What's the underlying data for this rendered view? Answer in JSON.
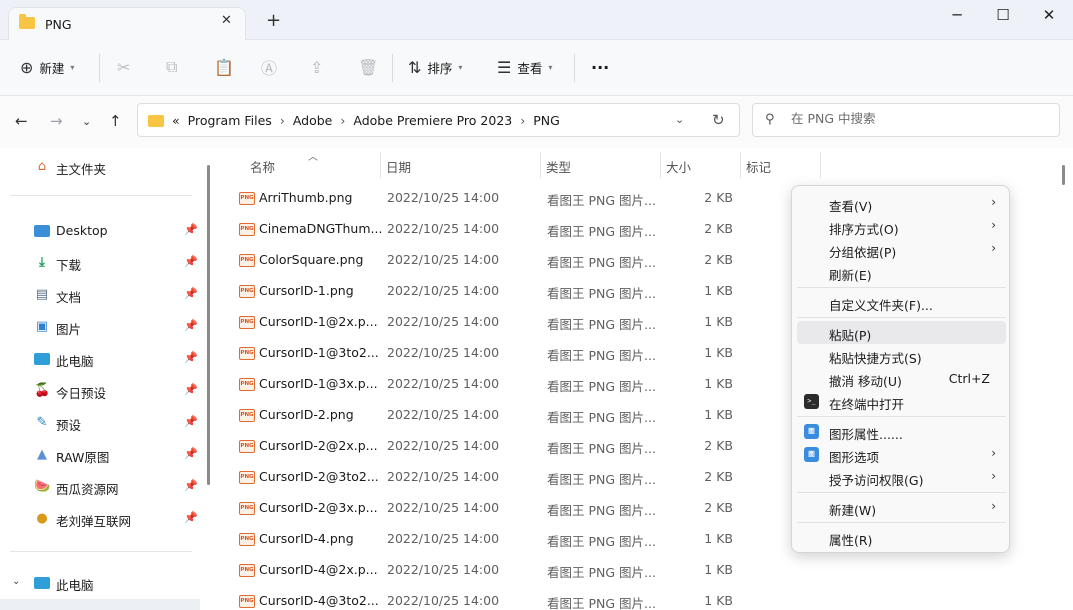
{
  "window": {
    "tab_title": "PNG",
    "tab_close": "✕",
    "new_tab": "+",
    "minimize": "─",
    "maximize": "☐",
    "close": "✕"
  },
  "toolbar": {
    "new_label": "新建",
    "sort_label": "排序",
    "view_label": "查看",
    "more_label": "···"
  },
  "address": {
    "overflow": "«",
    "crumbs": [
      "Program Files",
      "Adobe",
      "Adobe Premiere Pro 2023",
      "PNG"
    ],
    "sep": "›"
  },
  "search": {
    "placeholder": "在 PNG 中搜索"
  },
  "sidebar": {
    "home": "主文件夹",
    "items": [
      {
        "label": "Desktop",
        "icon": "desktop-icon"
      },
      {
        "label": "下载",
        "icon": "download-icon"
      },
      {
        "label": "文档",
        "icon": "document-icon"
      },
      {
        "label": "图片",
        "icon": "pictures-icon"
      },
      {
        "label": "此电脑",
        "icon": "computer-icon"
      },
      {
        "label": "今日预设",
        "icon": "cherry-icon"
      },
      {
        "label": "预设",
        "icon": "preset-icon"
      },
      {
        "label": "RAW原图",
        "icon": "raw-icon"
      },
      {
        "label": "西瓜资源网",
        "icon": "watermelon-icon"
      },
      {
        "label": "老刘弹互联网",
        "icon": "globe-icon"
      }
    ],
    "this_pc": "此电脑"
  },
  "columns": {
    "name": "名称",
    "date": "日期",
    "type": "类型",
    "size": "大小",
    "tag": "标记"
  },
  "files": [
    {
      "name": "ArriThumb.png",
      "date": "2022/10/25 14:00",
      "type": "看图王 PNG 图片...",
      "size": "2 KB"
    },
    {
      "name": "CinemaDNGThum...",
      "date": "2022/10/25 14:00",
      "type": "看图王 PNG 图片...",
      "size": "2 KB"
    },
    {
      "name": "ColorSquare.png",
      "date": "2022/10/25 14:00",
      "type": "看图王 PNG 图片...",
      "size": "2 KB"
    },
    {
      "name": "CursorID-1.png",
      "date": "2022/10/25 14:00",
      "type": "看图王 PNG 图片...",
      "size": "1 KB"
    },
    {
      "name": "CursorID-1@2x.p...",
      "date": "2022/10/25 14:00",
      "type": "看图王 PNG 图片...",
      "size": "1 KB"
    },
    {
      "name": "CursorID-1@3to2...",
      "date": "2022/10/25 14:00",
      "type": "看图王 PNG 图片...",
      "size": "1 KB"
    },
    {
      "name": "CursorID-1@3x.p...",
      "date": "2022/10/25 14:00",
      "type": "看图王 PNG 图片...",
      "size": "1 KB"
    },
    {
      "name": "CursorID-2.png",
      "date": "2022/10/25 14:00",
      "type": "看图王 PNG 图片...",
      "size": "1 KB"
    },
    {
      "name": "CursorID-2@2x.p...",
      "date": "2022/10/25 14:00",
      "type": "看图王 PNG 图片...",
      "size": "2 KB"
    },
    {
      "name": "CursorID-2@3to2...",
      "date": "2022/10/25 14:00",
      "type": "看图王 PNG 图片...",
      "size": "2 KB"
    },
    {
      "name": "CursorID-2@3x.p...",
      "date": "2022/10/25 14:00",
      "type": "看图王 PNG 图片...",
      "size": "2 KB"
    },
    {
      "name": "CursorID-4.png",
      "date": "2022/10/25 14:00",
      "type": "看图王 PNG 图片...",
      "size": "1 KB"
    },
    {
      "name": "CursorID-4@2x.p...",
      "date": "2022/10/25 14:00",
      "type": "看图王 PNG 图片...",
      "size": "1 KB"
    },
    {
      "name": "CursorID-4@3to2...",
      "date": "2022/10/25 14:00",
      "type": "看图王 PNG 图片...",
      "size": "1 KB"
    }
  ],
  "context_menu": {
    "view": "查看(V)",
    "sort": "排序方式(O)",
    "group": "分组依据(P)",
    "refresh": "刷新(E)",
    "customize": "自定义文件夹(F)...",
    "paste": "粘贴(P)",
    "paste_shortcut": "粘贴快捷方式(S)",
    "undo": "撤消 移动(U)",
    "undo_shortcut": "Ctrl+Z",
    "terminal": "在终端中打开",
    "gfx_props": "图形属性......",
    "gfx_options": "图形选项",
    "give_access": "授予访问权限(G)",
    "new": "新建(W)",
    "properties": "属性(R)",
    "arrow": "›"
  },
  "colors": {
    "folder": "#f8c443",
    "png_badge": "#e26a2c",
    "titlebar": "#eef2f8"
  }
}
